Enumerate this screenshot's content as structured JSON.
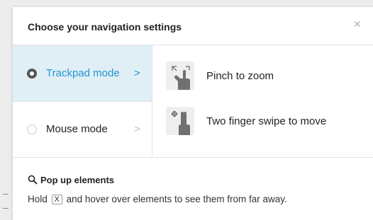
{
  "dialog": {
    "title": "Choose your navigation settings",
    "close_icon": "close-icon"
  },
  "modes": [
    {
      "label": "Trackpad mode",
      "selected": true,
      "chevron": ">"
    },
    {
      "label": "Mouse mode",
      "selected": false,
      "chevron": ">"
    }
  ],
  "gestures": [
    {
      "label": "Pinch to zoom",
      "icon": "pinch-zoom-icon"
    },
    {
      "label": "Two finger swipe to move",
      "icon": "two-finger-swipe-icon"
    }
  ],
  "popup": {
    "title": "Pop up elements",
    "icon": "search-icon",
    "desc_before": "Hold",
    "key": "X",
    "desc_after": "and hover over elements to see them from far away."
  },
  "colors": {
    "accent": "#1f96d1",
    "selected_bg": "#e0eef6",
    "border": "#e4e4e4",
    "text": "#222222"
  }
}
